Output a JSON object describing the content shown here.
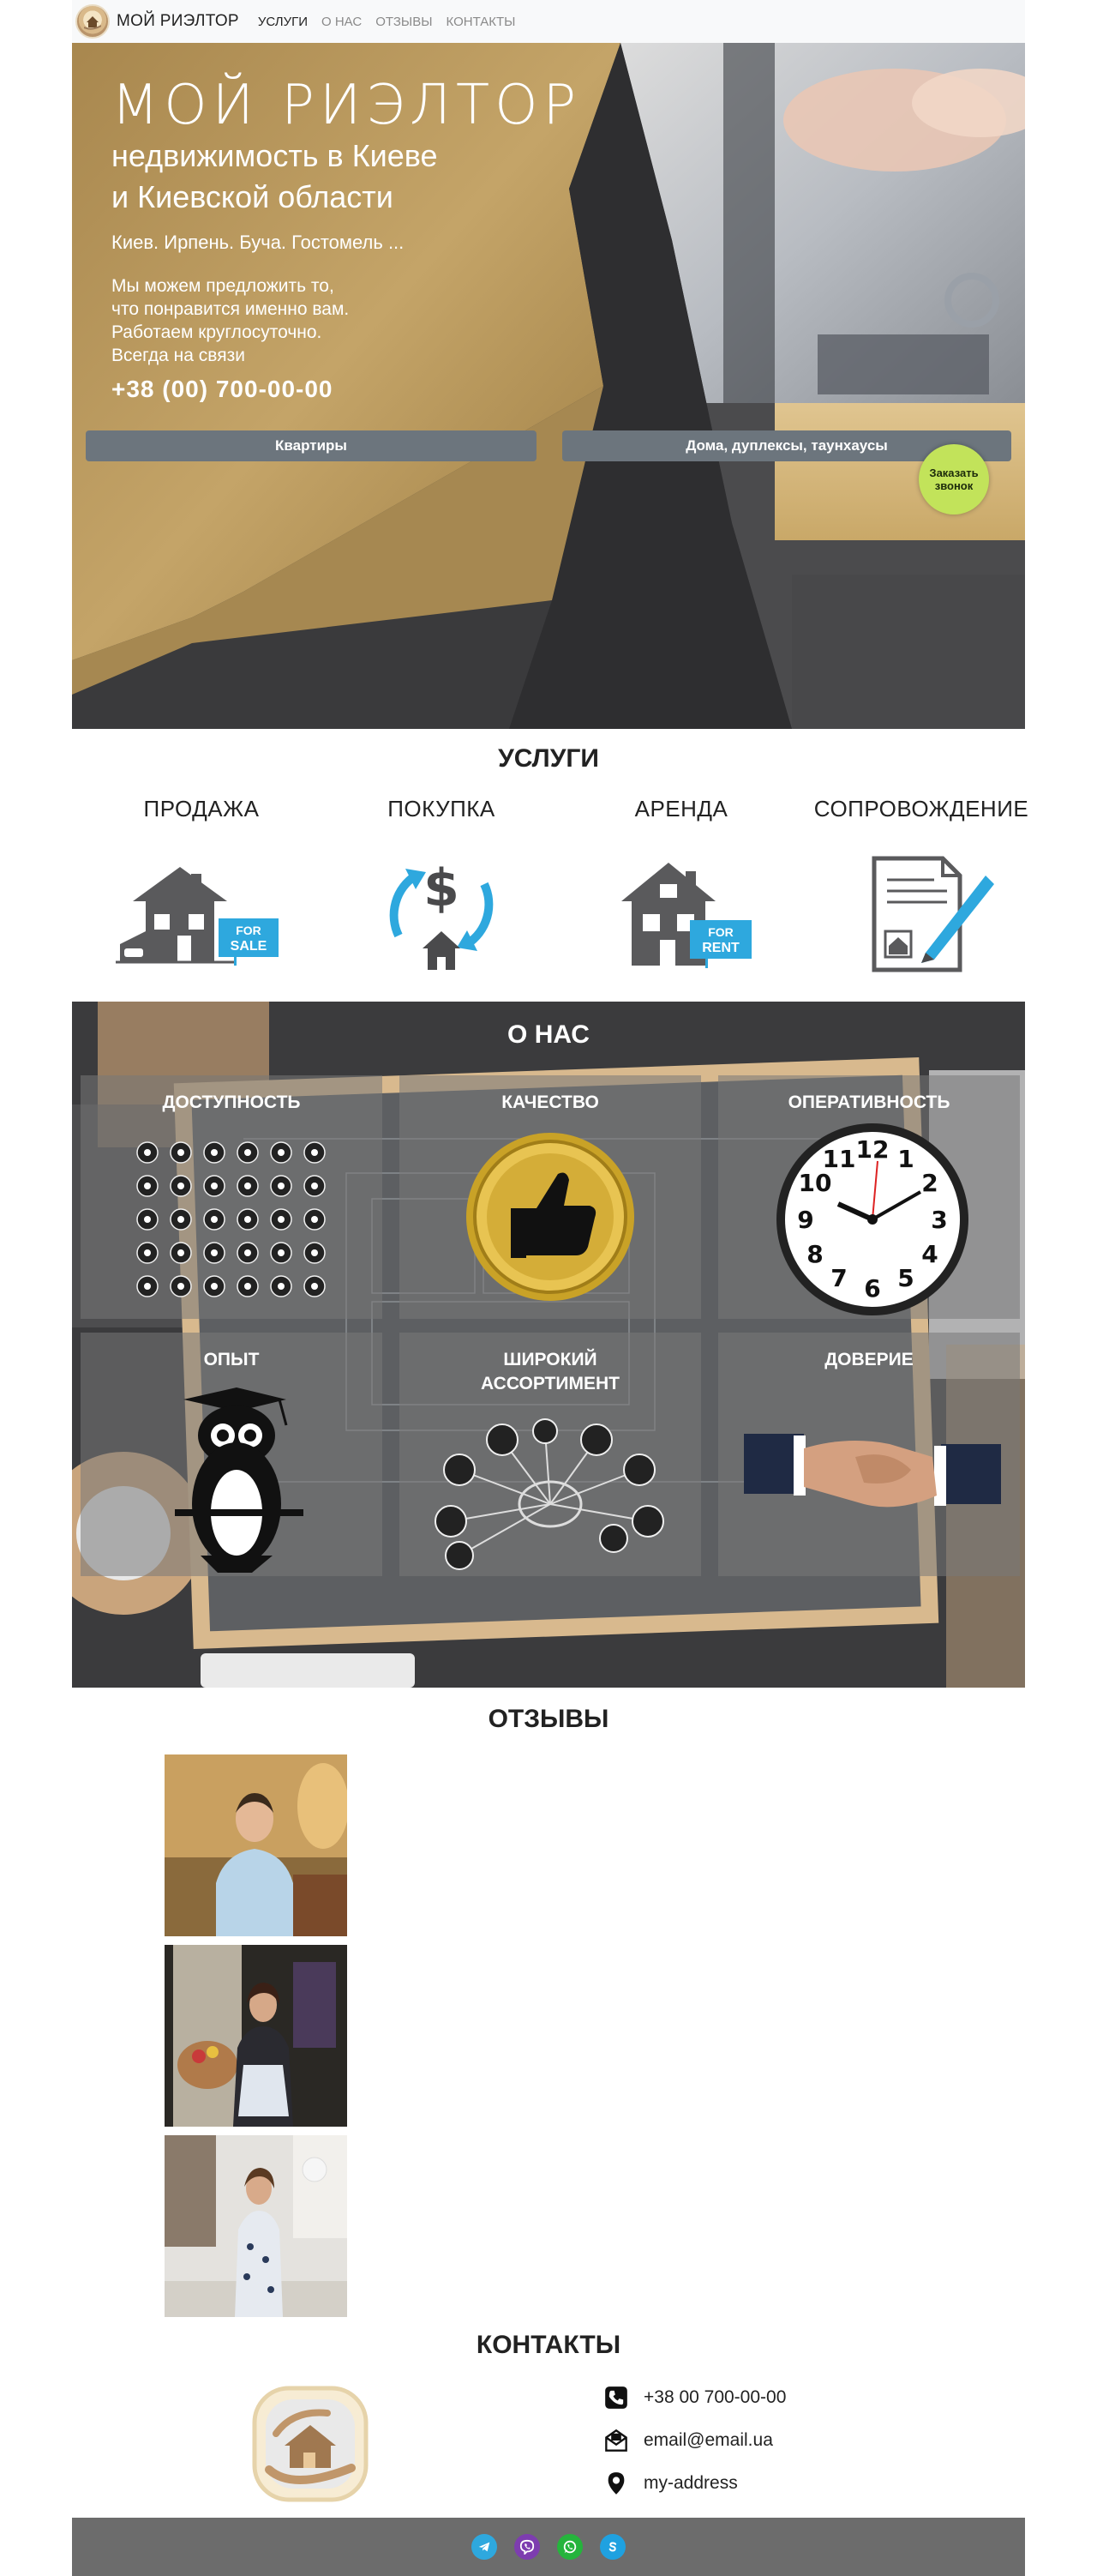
{
  "nav": {
    "brand": "МОЙ РИЭЛТОР",
    "links": [
      "УСЛУГИ",
      "О НАС",
      "ОТЗЫВЫ",
      "КОНТАКТЫ"
    ]
  },
  "hero": {
    "title": "МОЙ РИЭЛТОР",
    "subtitle_line1": "недвижимость в Киеве",
    "subtitle_line2": "и Киевской области",
    "cities": "Киев. Ирпень. Буча. Гостомель ...",
    "desc_lines": [
      "Мы можем предложить то,",
      "что понравится именно вам.",
      "Работаем круглосуточно.",
      "Всегда на связи"
    ],
    "phone": "+38 (00) 700-00-00",
    "btn_apartments": "Квартиры",
    "btn_houses": "Дома, дуплексы, таунхаусы",
    "callback_line1": "Заказать",
    "callback_line2": "звонок"
  },
  "services": {
    "title": "УСЛУГИ",
    "items": [
      {
        "label": "ПРОДАЖА",
        "sign": "FOR SALE"
      },
      {
        "label": "ПОКУПКА"
      },
      {
        "label": "АРЕНДА",
        "sign": "FOR RENT"
      },
      {
        "label": "СОПРОВОЖДЕНИЕ"
      }
    ]
  },
  "about": {
    "title": "О НАС",
    "tiles": [
      "ДОСТУПНОСТЬ",
      "КАЧЕСТВО",
      "ОПЕРАТИВНОСТЬ",
      "ОПЫТ",
      "ШИРОКИЙ АССОРТИМЕНТ",
      "ДОВЕРИЕ"
    ],
    "clock_numbers": [
      "12",
      "1",
      "2",
      "3",
      "4",
      "5",
      "6",
      "7",
      "8",
      "9",
      "10",
      "11"
    ]
  },
  "reviews": {
    "title": "ОТЗЫВЫ"
  },
  "contacts": {
    "title": "КОНТАКТЫ",
    "phone": "+38 00 700-00-00",
    "email": "email@email.ua",
    "address": "my-address"
  },
  "colors": {
    "gold": "#b8975a",
    "dark": "#4a4a4c",
    "button": "#6c757d",
    "callback": "#c2e35a",
    "blue": "#2ea8de"
  }
}
